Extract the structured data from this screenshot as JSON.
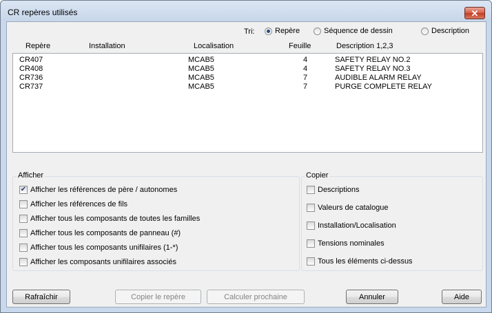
{
  "window": {
    "title": "CR repères utilisés",
    "close_glyph": "✕"
  },
  "sort": {
    "label": "Tri:",
    "options": [
      {
        "label": "Repère",
        "selected": true
      },
      {
        "label": "Séquence de dessin",
        "selected": false
      },
      {
        "label": "Description",
        "selected": false
      }
    ]
  },
  "table": {
    "columns": [
      "Repère",
      "Installation",
      "Localisation",
      "Feuille",
      "Description 1,2,3"
    ],
    "rows": [
      {
        "repere": "CR407",
        "installation": "",
        "localisation": "MCAB5",
        "feuille": "4",
        "description": "SAFETY RELAY NO.2"
      },
      {
        "repere": "CR408",
        "installation": "",
        "localisation": "MCAB5",
        "feuille": "4",
        "description": "SAFETY RELAY NO.3"
      },
      {
        "repere": "CR736",
        "installation": "",
        "localisation": "MCAB5",
        "feuille": "7",
        "description": "AUDIBLE ALARM RELAY"
      },
      {
        "repere": "CR737",
        "installation": "",
        "localisation": "MCAB5",
        "feuille": "7",
        "description": "PURGE COMPLETE RELAY"
      }
    ]
  },
  "afficher": {
    "label": "Afficher",
    "items": [
      {
        "label": "Afficher les références de père / autonomes",
        "checked": true
      },
      {
        "label": "Afficher les références de fils",
        "checked": false
      },
      {
        "label": "Afficher tous les composants de toutes les familles",
        "checked": false
      },
      {
        "label": "Afficher tous les composants de panneau (#)",
        "checked": false
      },
      {
        "label": "Afficher tous les composants unifilaires (1-*)",
        "checked": false
      },
      {
        "label": "Afficher les composants unifilaires associés",
        "checked": false
      }
    ]
  },
  "copier": {
    "label": "Copier",
    "items": [
      {
        "label": "Descriptions",
        "checked": false
      },
      {
        "label": "Valeurs de catalogue",
        "checked": false
      },
      {
        "label": "Installation/Localisation",
        "checked": false
      },
      {
        "label": "Tensions nominales",
        "checked": false
      },
      {
        "label": "Tous les éléments ci-dessus",
        "checked": false
      }
    ]
  },
  "buttons": {
    "refresh": "Rafraîchir",
    "copy_tag": "Copier le repère",
    "calc_next": "Calculer prochaine",
    "cancel": "Annuler",
    "help": "Aide"
  }
}
